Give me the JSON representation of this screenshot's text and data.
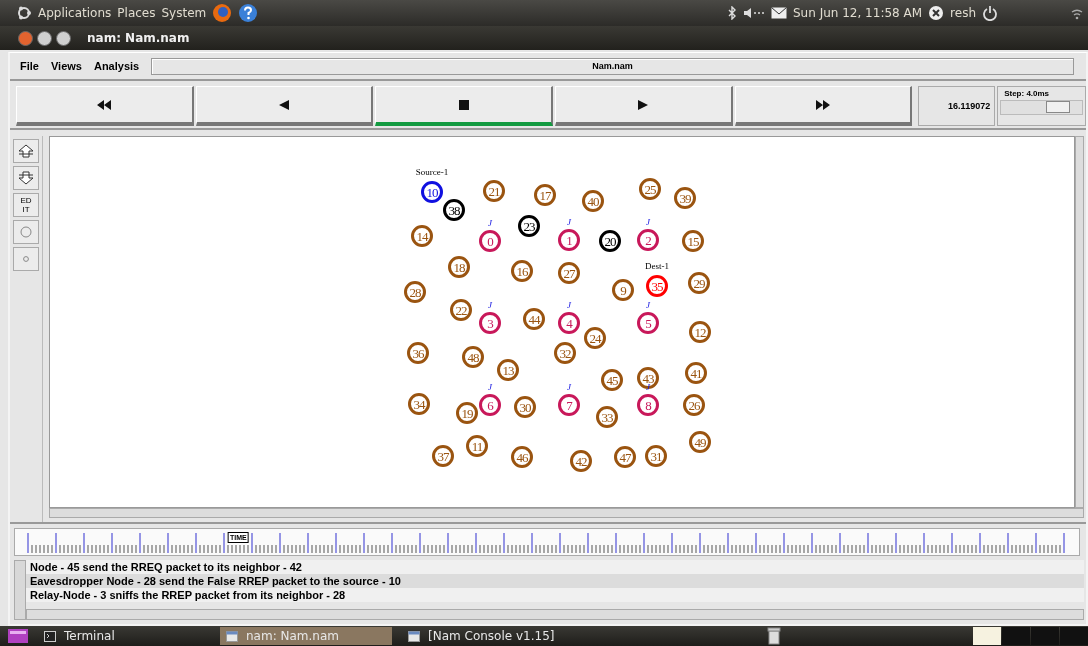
{
  "top_panel": {
    "menus": [
      "Applications",
      "Places",
      "System"
    ],
    "clock": "Sun Jun 12, 11:58 AM",
    "user": "resh"
  },
  "window": {
    "title": "nam: Nam.nam"
  },
  "menu_bar": {
    "items": [
      "File",
      "Views",
      "Analysis"
    ],
    "file_field": "Nam.nam"
  },
  "controls": [
    {
      "kind": "rewind",
      "selected": false
    },
    {
      "kind": "back",
      "selected": false
    },
    {
      "kind": "stop",
      "selected": true
    },
    {
      "kind": "play",
      "selected": false
    },
    {
      "kind": "forward",
      "selected": false
    }
  ],
  "time": "16.119072",
  "step": {
    "label": "Step: 4.0ms",
    "level": 0.72
  },
  "tools": [
    {
      "kind": "zoom-in"
    },
    {
      "kind": "zoom-out"
    },
    {
      "kind": "edit",
      "label": "ED IT"
    },
    {
      "kind": "big-circle"
    },
    {
      "kind": "small-circle"
    }
  ],
  "nodes": [
    {
      "label": "10",
      "color": "#1010e0",
      "tag": "Source-1"
    },
    {
      "label": "38",
      "color": "#000000"
    },
    {
      "label": "21",
      "color": "#9a5410"
    },
    {
      "label": "17",
      "color": "#9a5410"
    },
    {
      "label": "40",
      "color": "#9a5410"
    },
    {
      "label": "25",
      "color": "#9a5410"
    },
    {
      "label": "39",
      "color": "#9a5410"
    },
    {
      "label": "14",
      "color": "#9a5410"
    },
    {
      "label": "0",
      "color": "#c8185a",
      "tag": "J"
    },
    {
      "label": "23",
      "color": "#000000"
    },
    {
      "label": "1",
      "color": "#c8185a",
      "tag": "J"
    },
    {
      "label": "20",
      "color": "#000000"
    },
    {
      "label": "2",
      "color": "#c8185a",
      "tag": "J"
    },
    {
      "label": "15",
      "color": "#9a5410"
    },
    {
      "label": "18",
      "color": "#9a5410"
    },
    {
      "label": "16",
      "color": "#9a5410"
    },
    {
      "label": "27",
      "color": "#9a5410"
    },
    {
      "label": "9",
      "color": "#9a5410"
    },
    {
      "label": "35",
      "color": "#ff0000",
      "tag": "Dest-1"
    },
    {
      "label": "29",
      "color": "#9a5410"
    },
    {
      "label": "28",
      "color": "#9a5410"
    },
    {
      "label": "22",
      "color": "#9a5410"
    },
    {
      "label": "3",
      "color": "#c8185a",
      "tag": "J"
    },
    {
      "label": "44",
      "color": "#9a5410"
    },
    {
      "label": "4",
      "color": "#c8185a",
      "tag": "J"
    },
    {
      "label": "24",
      "color": "#9a5410"
    },
    {
      "label": "5",
      "color": "#c8185a",
      "tag": "J"
    },
    {
      "label": "12",
      "color": "#9a5410"
    },
    {
      "label": "36",
      "color": "#9a5410"
    },
    {
      "label": "48",
      "color": "#9a5410"
    },
    {
      "label": "13",
      "color": "#9a5410"
    },
    {
      "label": "32",
      "color": "#9a5410"
    },
    {
      "label": "45",
      "color": "#9a5410"
    },
    {
      "label": "43",
      "color": "#9a5410"
    },
    {
      "label": "41",
      "color": "#9a5410"
    },
    {
      "label": "34",
      "color": "#9a5410"
    },
    {
      "label": "19",
      "color": "#9a5410"
    },
    {
      "label": "6",
      "color": "#c8185a",
      "tag": "J"
    },
    {
      "label": "30",
      "color": "#9a5410"
    },
    {
      "label": "7",
      "color": "#c8185a",
      "tag": "J"
    },
    {
      "label": "33",
      "color": "#9a5410"
    },
    {
      "label": "8",
      "color": "#c8185a",
      "tag": "J"
    },
    {
      "label": "26",
      "color": "#9a5410"
    },
    {
      "label": "49",
      "color": "#9a5410"
    },
    {
      "label": "37",
      "color": "#9a5410"
    },
    {
      "label": "11",
      "color": "#9a5410"
    },
    {
      "label": "46",
      "color": "#9a5410"
    },
    {
      "label": "42",
      "color": "#9a5410"
    },
    {
      "label": "47",
      "color": "#9a5410"
    },
    {
      "label": "31",
      "color": "#9a5410"
    }
  ],
  "timeline": {
    "marker": "TIME",
    "level": 0.21
  },
  "log": [
    {
      "text": "Node - 45 send the RREQ packet to its neighbor - 42",
      "selected": false
    },
    {
      "text": "Eavesdropper Node - 28 send the False RREP packet to the source - 10",
      "selected": true
    },
    {
      "text": "Relay-Node - 3 sniffs the RREP packet from its neighbor - 28",
      "selected": false
    }
  ],
  "taskbar": [
    {
      "label": "Terminal",
      "kind": "terminal",
      "selected": false
    },
    {
      "label": "nam: Nam.nam",
      "kind": "window",
      "selected": true
    },
    {
      "label": "[Nam Console v1.15]",
      "kind": "window",
      "selected": false
    }
  ]
}
